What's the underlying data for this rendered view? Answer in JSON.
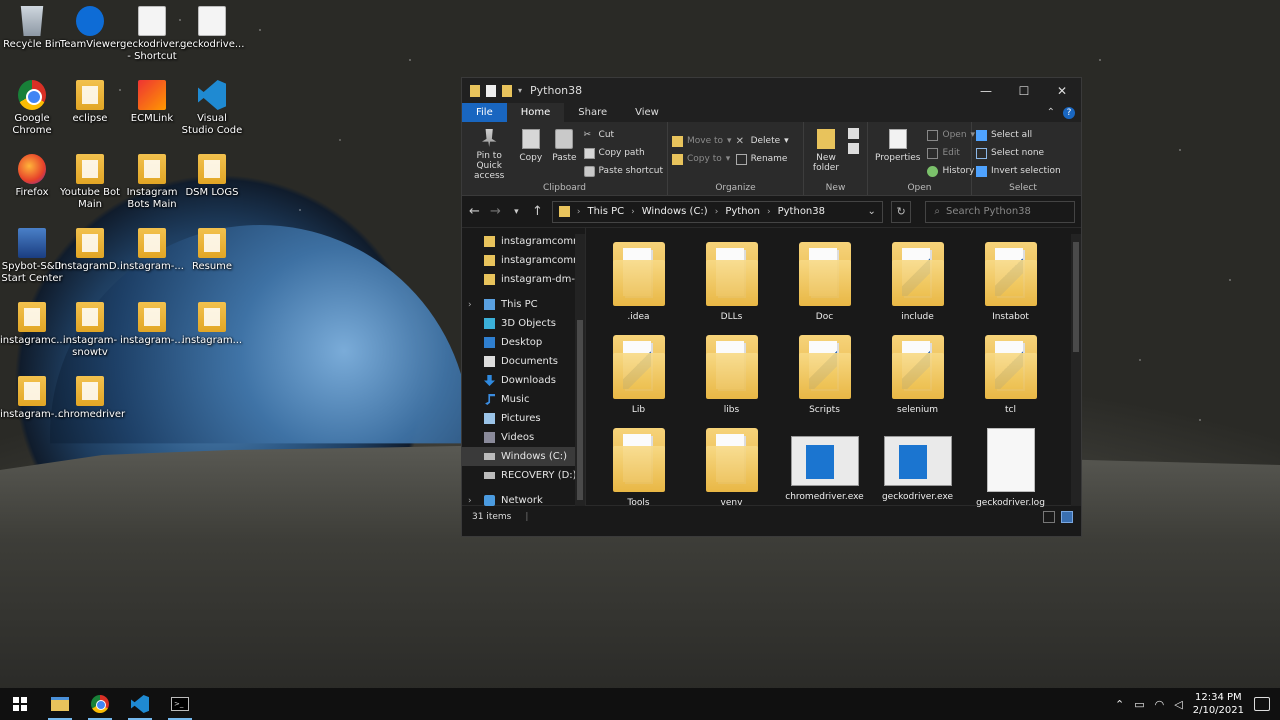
{
  "desktop": {
    "icons": [
      {
        "label": "Recycle Bin",
        "icon": "recycle-bin-icon"
      },
      {
        "label": "TeamViewer",
        "icon": "teamviewer-icon"
      },
      {
        "label": "geckodriver... - Shortcut",
        "icon": "shortcut-icon"
      },
      {
        "label": "geckodrive...",
        "icon": "file-icon"
      },
      {
        "label": "Google Chrome",
        "icon": "chrome-icon"
      },
      {
        "label": "eclipse",
        "icon": "folder-icon"
      },
      {
        "label": "ECMLink",
        "icon": "ecmlink-icon"
      },
      {
        "label": "Visual Studio Code",
        "icon": "vscode-icon"
      },
      {
        "label": "Firefox",
        "icon": "firefox-icon"
      },
      {
        "label": "Youtube Bot Main",
        "icon": "folder-icon"
      },
      {
        "label": "Instagram Bots Main",
        "icon": "folder-icon"
      },
      {
        "label": "DSM LOGS",
        "icon": "folder-icon"
      },
      {
        "label": "Spybot-S&D Start Center",
        "icon": "spybot-icon"
      },
      {
        "label": "InstagramD...",
        "icon": "folder-icon"
      },
      {
        "label": "instagram-...",
        "icon": "folder-icon"
      },
      {
        "label": "Resume",
        "icon": "folder-icon"
      },
      {
        "label": "instagramc...",
        "icon": "folder-icon"
      },
      {
        "label": "instagram-snowtv",
        "icon": "folder-icon"
      },
      {
        "label": "instagram-...",
        "icon": "folder-icon"
      },
      {
        "label": "instagram...",
        "icon": "folder-icon"
      },
      {
        "label": "instagram-...",
        "icon": "folder-icon"
      },
      {
        "label": "chromedriver",
        "icon": "folder-icon"
      }
    ]
  },
  "explorer": {
    "title": "Python38",
    "window_controls": {
      "minimize": "—",
      "maximize": "☐",
      "close": "✕"
    },
    "menu": {
      "file": "File",
      "home": "Home",
      "share": "Share",
      "view": "View"
    },
    "ribbon": {
      "clipboard": {
        "label": "Clipboard",
        "pin": "Pin to Quick access",
        "copy": "Copy",
        "paste": "Paste",
        "cut": "Cut",
        "copy_path": "Copy path",
        "paste_shortcut": "Paste shortcut"
      },
      "organize": {
        "label": "Organize",
        "move_to": "Move to",
        "copy_to": "Copy to",
        "delete": "Delete",
        "rename": "Rename"
      },
      "new": {
        "label": "New",
        "new_folder": "New folder"
      },
      "open": {
        "label": "Open",
        "properties": "Properties",
        "open": "Open",
        "edit": "Edit",
        "history": "History"
      },
      "select": {
        "label": "Select",
        "select_all": "Select all",
        "select_none": "Select none",
        "invert": "Invert selection"
      }
    },
    "address": {
      "crumbs": [
        "This PC",
        "Windows (C:)",
        "Python",
        "Python38"
      ],
      "search_placeholder": "Search Python38"
    },
    "nav_pane": [
      {
        "label": "instagramcomm",
        "icon": "folder-icon"
      },
      {
        "label": "instagramcomm",
        "icon": "folder-icon"
      },
      {
        "label": "instagram-dm-b",
        "icon": "folder-icon"
      },
      {
        "label": "This PC",
        "icon": "pc-icon"
      },
      {
        "label": "3D Objects",
        "icon": "3d-objects-icon"
      },
      {
        "label": "Desktop",
        "icon": "desktop-icon"
      },
      {
        "label": "Documents",
        "icon": "documents-icon"
      },
      {
        "label": "Downloads",
        "icon": "downloads-icon"
      },
      {
        "label": "Music",
        "icon": "music-icon"
      },
      {
        "label": "Pictures",
        "icon": "pictures-icon"
      },
      {
        "label": "Videos",
        "icon": "videos-icon"
      },
      {
        "label": "Windows (C:)",
        "icon": "drive-icon"
      },
      {
        "label": "RECOVERY (D:)",
        "icon": "drive-icon"
      },
      {
        "label": "Network",
        "icon": "network-icon"
      }
    ],
    "files": [
      {
        "name": ".idea",
        "type": "folder"
      },
      {
        "name": "DLLs",
        "type": "folder"
      },
      {
        "name": "Doc",
        "type": "folder"
      },
      {
        "name": "include",
        "type": "folder"
      },
      {
        "name": "Instabot",
        "type": "folder"
      },
      {
        "name": "Lib",
        "type": "folder"
      },
      {
        "name": "libs",
        "type": "folder"
      },
      {
        "name": "Scripts",
        "type": "folder"
      },
      {
        "name": "selenium",
        "type": "folder"
      },
      {
        "name": "tcl",
        "type": "folder"
      },
      {
        "name": "Tools",
        "type": "folder"
      },
      {
        "name": "venv",
        "type": "folder"
      },
      {
        "name": "chromedriver.exe",
        "type": "exe"
      },
      {
        "name": "geckodriver.exe",
        "type": "exe"
      },
      {
        "name": "geckodriver.log",
        "type": "log"
      }
    ],
    "status": {
      "count": "31 items"
    }
  },
  "taskbar": {
    "time": "12:34 PM",
    "date": "2/10/2021"
  }
}
